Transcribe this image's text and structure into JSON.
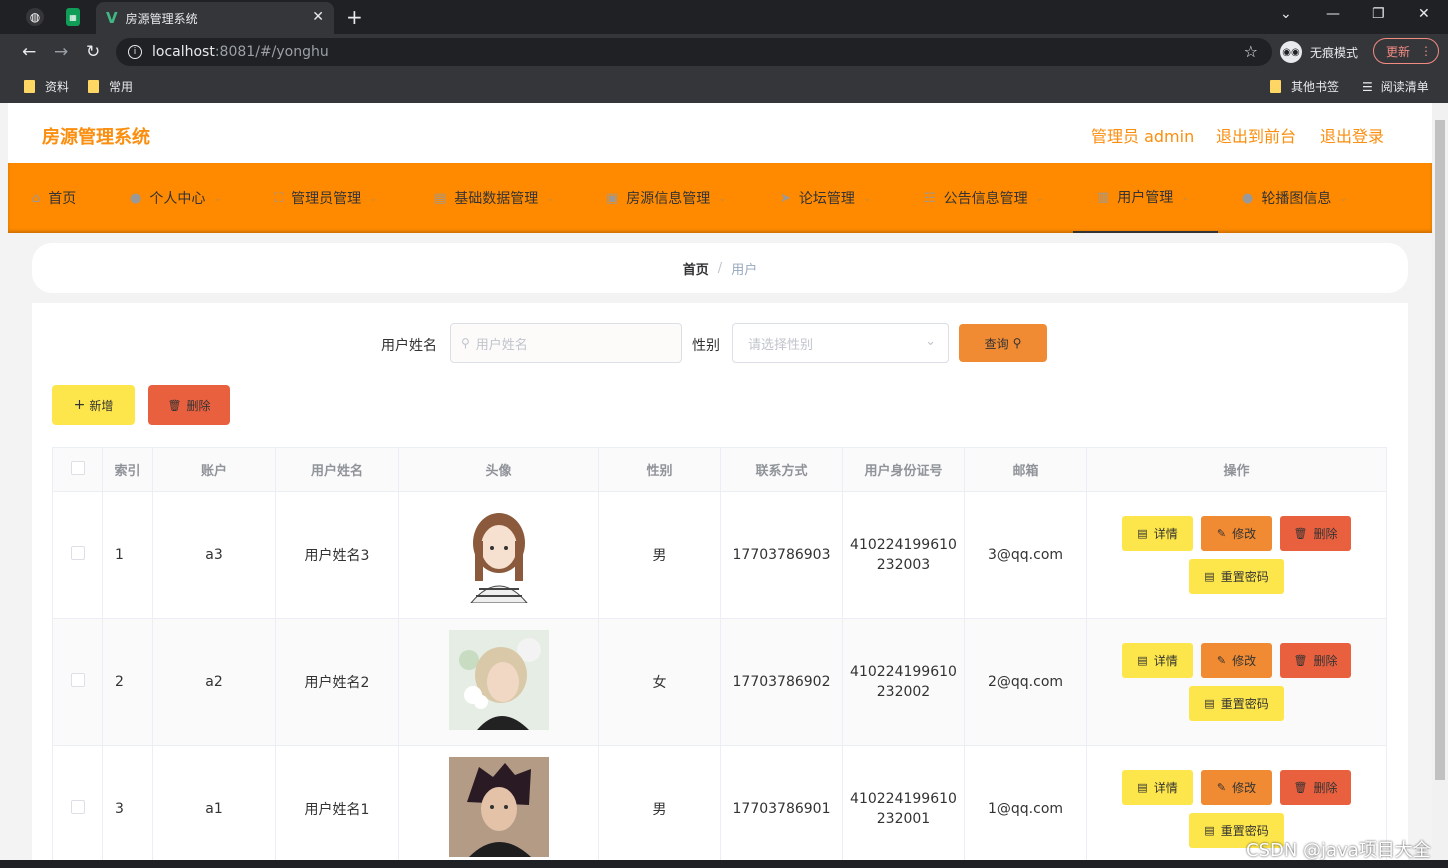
{
  "browser": {
    "tab_title": "房源管理系统",
    "url_host": "localhost",
    "url_path": ":8081/#/yonghu",
    "incognito_label": "无痕模式",
    "update_label": "更新",
    "bookmarks": [
      "资料",
      "常用"
    ],
    "other_bookmarks": "其他书签",
    "reading_list": "阅读清单"
  },
  "header": {
    "brand": "房源管理系统",
    "user": "管理员 admin",
    "to_front": "退出到前台",
    "logout": "退出登录"
  },
  "menu": [
    {
      "label": "首页",
      "icon": "home-icon",
      "chevron": false
    },
    {
      "label": "个人中心",
      "icon": "user-icon",
      "chevron": true
    },
    {
      "label": "管理员管理",
      "icon": "frame-icon",
      "chevron": true
    },
    {
      "label": "基础数据管理",
      "icon": "database-icon",
      "chevron": true
    },
    {
      "label": "房源信息管理",
      "icon": "briefcase-icon",
      "chevron": true
    },
    {
      "label": "论坛管理",
      "icon": "send-icon",
      "chevron": true
    },
    {
      "label": "公告信息管理",
      "icon": "sliders-icon",
      "chevron": true
    },
    {
      "label": "用户管理",
      "icon": "clipboard-icon",
      "chevron": true
    },
    {
      "label": "轮播图信息",
      "icon": "map-pin-icon",
      "chevron": true
    }
  ],
  "breadcrumb": {
    "home": "首页",
    "separator": "/",
    "current": "用户"
  },
  "search": {
    "name_label": "用户姓名",
    "name_placeholder": "用户姓名",
    "gender_label": "性别",
    "gender_placeholder": "请选择性别",
    "query_label": "查询"
  },
  "actions": {
    "add_label": "新增",
    "delete_label": "删除"
  },
  "table": {
    "headers": [
      "",
      "索引",
      "账户",
      "用户姓名",
      "头像",
      "性别",
      "联系方式",
      "用户身份证号",
      "邮箱",
      "操作"
    ],
    "rows": [
      {
        "index": "1",
        "account": "a3",
        "name": "用户姓名3",
        "gender": "男",
        "phone": "17703786903",
        "id_line1": "410224199610",
        "id_line2": "232003",
        "email": "3@qq.com"
      },
      {
        "index": "2",
        "account": "a2",
        "name": "用户姓名2",
        "gender": "女",
        "phone": "17703786902",
        "id_line1": "410224199610",
        "id_line2": "232002",
        "email": "2@qq.com"
      },
      {
        "index": "3",
        "account": "a1",
        "name": "用户姓名1",
        "gender": "男",
        "phone": "17703786901",
        "id_line1": "410224199610",
        "id_line2": "232001",
        "email": "1@qq.com"
      }
    ],
    "ops": {
      "detail": "详情",
      "edit": "修改",
      "delete": "删除",
      "reset": "重置密码"
    }
  },
  "colors": {
    "accent": "#fb8e0e",
    "menu_bg": "#ff8a00",
    "query_btn": "#f08b33",
    "add_btn": "#fde64b",
    "delete_btn": "#e9603f"
  },
  "watermark": "CSDN @java项目大全"
}
